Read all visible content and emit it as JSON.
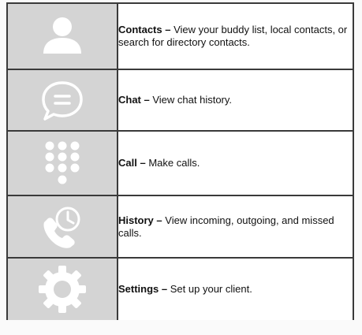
{
  "features": [
    {
      "icon": "contacts-person-icon",
      "name": "Contacts",
      "separator": " – ",
      "description": "View your buddy list, local contacts, or search for directory contacts."
    },
    {
      "icon": "chat-bubble-icon",
      "name": "Chat",
      "separator": " – ",
      "description": "View chat history."
    },
    {
      "icon": "dialpad-icon",
      "name": "Call",
      "separator": " – ",
      "description": "Make calls."
    },
    {
      "icon": "history-phone-clock-icon",
      "name": "History",
      "separator": " – ",
      "description": "View incoming, outgoing, and missed calls."
    },
    {
      "icon": "settings-gear-icon",
      "name": "Settings",
      "separator": " – ",
      "description": "Set up your client."
    }
  ],
  "colors": {
    "icon_background": "#d4d4d4",
    "icon_foreground": "#ffffff",
    "border": "#3a3a3a",
    "text": "#111111"
  }
}
